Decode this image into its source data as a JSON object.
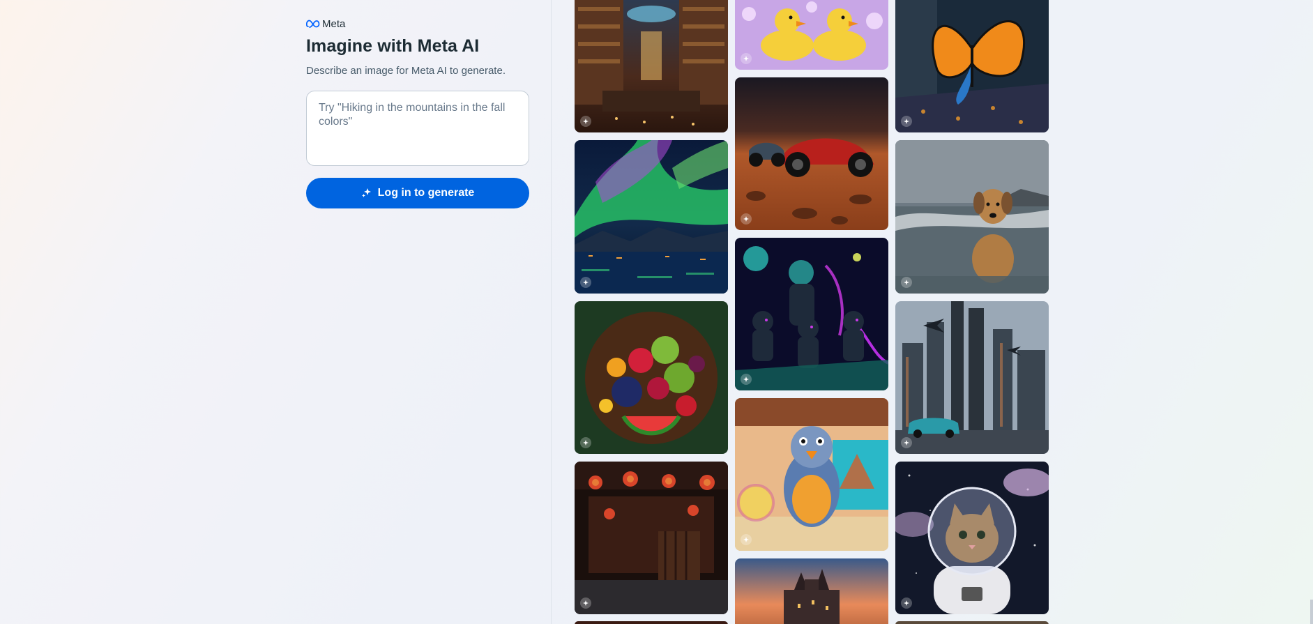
{
  "brand": {
    "name": "Meta"
  },
  "header": {
    "title": "Imagine with Meta AI",
    "subtitle": "Describe an image for Meta AI to generate."
  },
  "prompt": {
    "placeholder": "Try \"Hiking in the mountains in the fall colors\"",
    "value": ""
  },
  "generate_button": {
    "label": "Log in to generate",
    "icon": "sparkle-icon"
  },
  "colors": {
    "accent": "#0064e0",
    "text": "#1c2b33",
    "muted": "#465a69"
  },
  "gallery": [
    {
      "name": "image-library",
      "icon": "imagine-badge-icon"
    },
    {
      "name": "image-aurora",
      "icon": "imagine-badge-icon"
    },
    {
      "name": "image-fruit-platter",
      "icon": "imagine-badge-icon"
    },
    {
      "name": "image-lantern-house",
      "icon": "imagine-badge-icon"
    },
    {
      "name": "image-rubber-ducks",
      "icon": "imagine-badge-icon"
    },
    {
      "name": "image-desert-race-car",
      "icon": "imagine-badge-icon"
    },
    {
      "name": "image-space-cats",
      "icon": "imagine-badge-icon"
    },
    {
      "name": "image-baby-bird-beach",
      "icon": "imagine-badge-icon"
    },
    {
      "name": "image-castle-sunset",
      "icon": "imagine-badge-icon"
    },
    {
      "name": "image-butterfly-street",
      "icon": "imagine-badge-icon"
    },
    {
      "name": "image-dog-in-sea",
      "icon": "imagine-badge-icon"
    },
    {
      "name": "image-futuristic-city",
      "icon": "imagine-badge-icon"
    },
    {
      "name": "image-astronaut-kitten",
      "icon": "imagine-badge-icon"
    }
  ]
}
